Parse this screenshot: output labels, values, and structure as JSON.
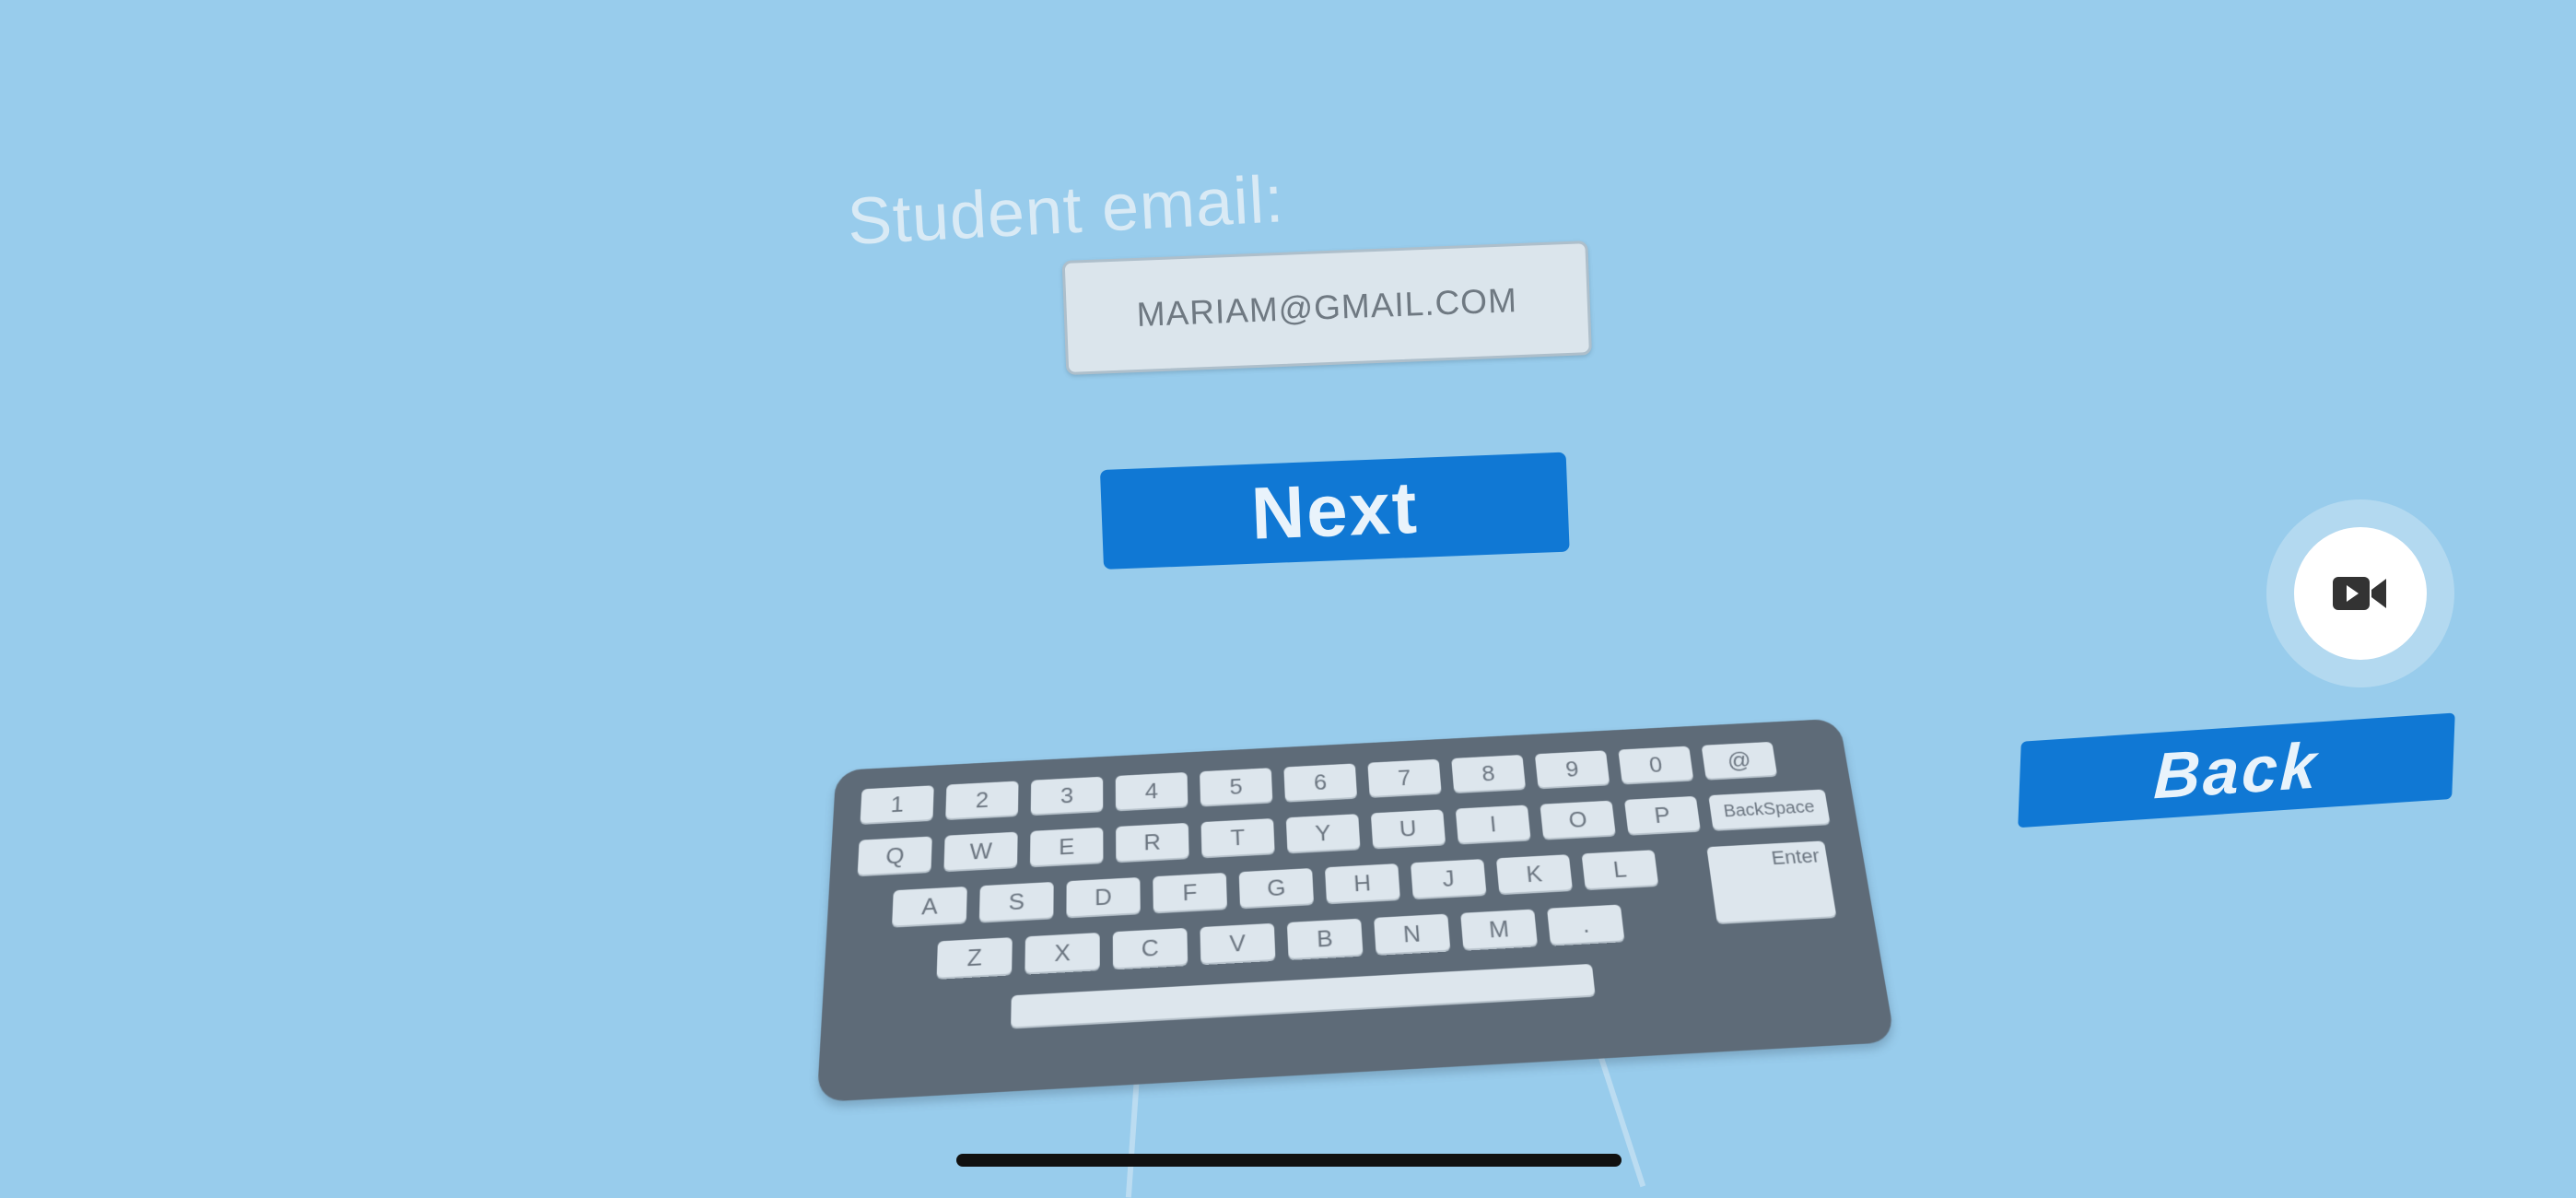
{
  "form": {
    "email_label": "Student email:",
    "email_value": "MARIAM@GMAIL.COM",
    "next_label": "Next",
    "back_label": "Back"
  },
  "record_button": {
    "icon": "video-camera-icon"
  },
  "keyboard": {
    "row1": [
      "1",
      "2",
      "3",
      "4",
      "5",
      "6",
      "7",
      "8",
      "9",
      "0",
      "@"
    ],
    "row2": [
      "Q",
      "W",
      "E",
      "R",
      "T",
      "Y",
      "U",
      "I",
      "O",
      "P"
    ],
    "backspace": "BackSpace",
    "row3": [
      "A",
      "S",
      "D",
      "F",
      "G",
      "H",
      "J",
      "K",
      "L"
    ],
    "enter": "Enter",
    "row4": [
      "Z",
      "X",
      "C",
      "V",
      "B",
      "N",
      "M",
      "."
    ]
  },
  "colors": {
    "background": "#98ccec",
    "button": "#1078d4",
    "keyboard_body": "#5e6b78",
    "key": "#dde6ed"
  }
}
